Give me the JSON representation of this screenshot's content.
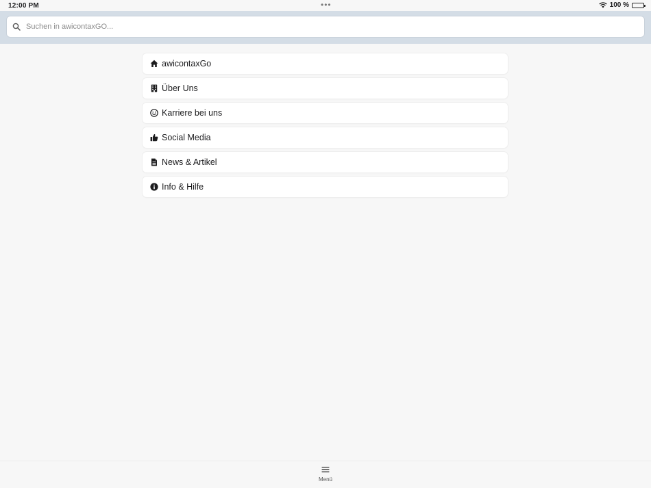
{
  "status_bar": {
    "time": "12:00 PM",
    "dots": "•••",
    "battery_text": "100 %"
  },
  "search": {
    "placeholder": "Suchen in awicontaxGO...",
    "value": ""
  },
  "menu": {
    "items": [
      {
        "label": "awicontaxGo",
        "icon": "home-icon"
      },
      {
        "label": "Über Uns",
        "icon": "building-icon"
      },
      {
        "label": "Karriere bei uns",
        "icon": "smile-icon"
      },
      {
        "label": "Social Media",
        "icon": "thumbs-up-icon"
      },
      {
        "label": "News & Artikel",
        "icon": "document-icon"
      },
      {
        "label": "Info & Hilfe",
        "icon": "info-icon"
      }
    ]
  },
  "tab_bar": {
    "menu_label": "Menü",
    "menu_icon": "hamburger-icon"
  },
  "colors": {
    "background": "#f7f7f7",
    "search_band": "#d4dde6",
    "item_background": "#ffffff",
    "text": "#1c1c1e"
  }
}
